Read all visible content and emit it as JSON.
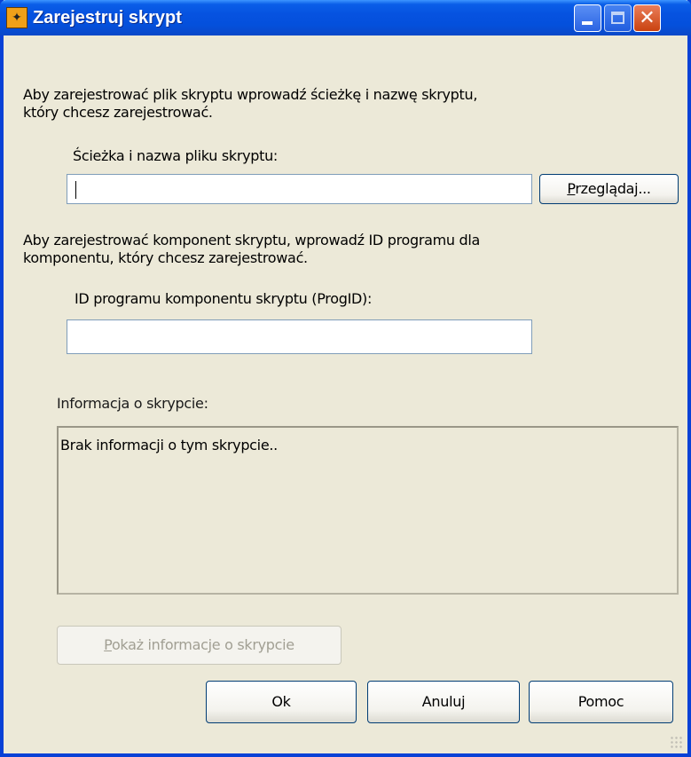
{
  "window": {
    "title": "Zarejestruj skrypt",
    "controls": {
      "minimize": "minimize",
      "maximize": "maximize",
      "close": "✕"
    }
  },
  "script_file": {
    "instruction_line1": "Aby zarejestrować plik skryptu wprowadź ścieżkę i nazwę skryptu,",
    "instruction_line2": "który chcesz zarejestrować.",
    "label": "Ścieżka i nazwa pliku skryptu:",
    "value": "",
    "browse_button": "Przeglądaj...",
    "browse_mnemonic": "P"
  },
  "component": {
    "instruction_line1": "Aby zarejestrować komponent skryptu, wprowadź ID programu dla",
    "instruction_line2": "komponentu, który chcesz zarejestrować.",
    "label": "ID programu komponentu skryptu (ProgID):",
    "value": ""
  },
  "info": {
    "label": "Informacja o skrypcie:",
    "text": "Brak informacji o tym skrypcie..",
    "show_button": "Pokaż informacje o skrypcie"
  },
  "buttons": {
    "ok": "Ok",
    "cancel": "Anuluj",
    "help": "Pomoc"
  },
  "colors": {
    "titlebar": "#0652e0",
    "dialog_bg": "#ece9d8",
    "close_button": "#c9420f"
  }
}
